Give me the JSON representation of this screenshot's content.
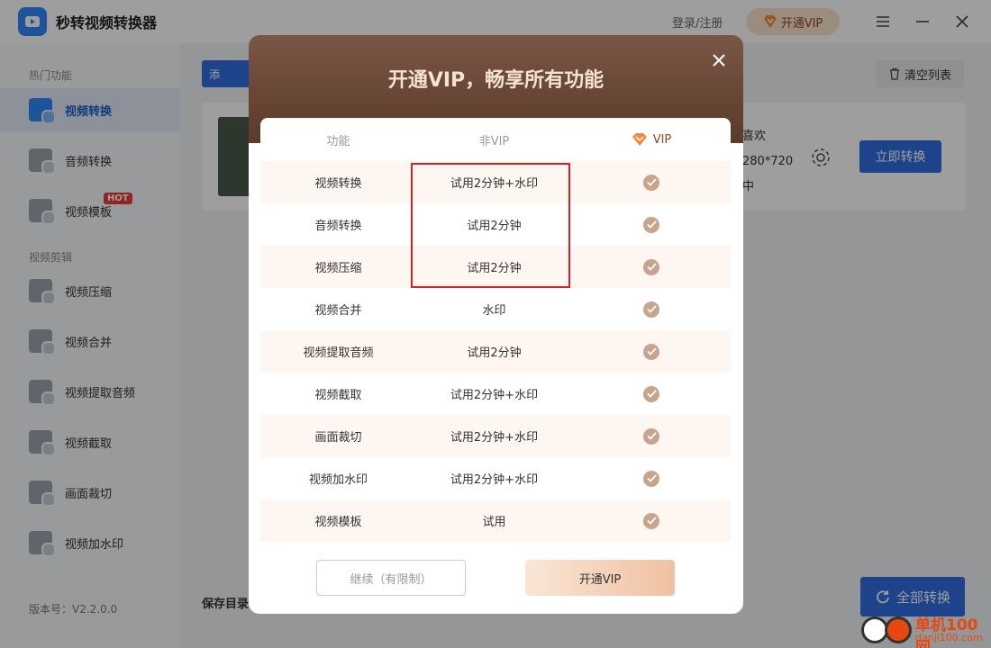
{
  "app": {
    "title": "秒转视频转换器",
    "login": "登录/注册",
    "vip_button": "开通VIP"
  },
  "sidebar": {
    "group_hot": "热门功能",
    "group_edit": "视频剪辑",
    "items": [
      {
        "label": "视频转换",
        "active": true
      },
      {
        "label": "音频转换"
      },
      {
        "label": "视频模板",
        "badge": "HOT"
      },
      {
        "label": "视频压缩"
      },
      {
        "label": "视频合并"
      },
      {
        "label": "视频提取音频"
      },
      {
        "label": "视频截取"
      },
      {
        "label": "画面裁切"
      },
      {
        "label": "视频加水印"
      }
    ],
    "version": "版本号：V2.2.0.0"
  },
  "main": {
    "add_label": "添",
    "clear_label": "清空列表",
    "file": {
      "name": "喜欢",
      "resolution": "280*720",
      "status": "中"
    },
    "convert_label": "立即转换",
    "save_dir_label": "保存目录",
    "all_convert_label": "全部转换"
  },
  "modal": {
    "title": "开通VIP，畅享所有功能",
    "headers": {
      "feature": "功能",
      "nonvip": "非VIP",
      "vip": "VIP"
    },
    "rows": [
      {
        "feature": "视频转换",
        "nonvip": "试用2分钟+水印"
      },
      {
        "feature": "音频转换",
        "nonvip": "试用2分钟"
      },
      {
        "feature": "视频压缩",
        "nonvip": "试用2分钟"
      },
      {
        "feature": "视频合并",
        "nonvip": "水印"
      },
      {
        "feature": "视频提取音频",
        "nonvip": "试用2分钟"
      },
      {
        "feature": "视频截取",
        "nonvip": "试用2分钟+水印"
      },
      {
        "feature": "画面裁切",
        "nonvip": "试用2分钟+水印"
      },
      {
        "feature": "视频加水印",
        "nonvip": "试用2分钟+水印"
      },
      {
        "feature": "视频模板",
        "nonvip": "试用"
      }
    ],
    "continue_label": "继续（有限制）",
    "open_vip_label": "开通VIP"
  },
  "watermark": {
    "text": "单机100网",
    "url": "danji100.com"
  },
  "colors": {
    "accent": "#2f6ee0",
    "modal_header": "#6a4636",
    "vip_gold": "#c9a48c",
    "highlight_border": "#e02020"
  }
}
